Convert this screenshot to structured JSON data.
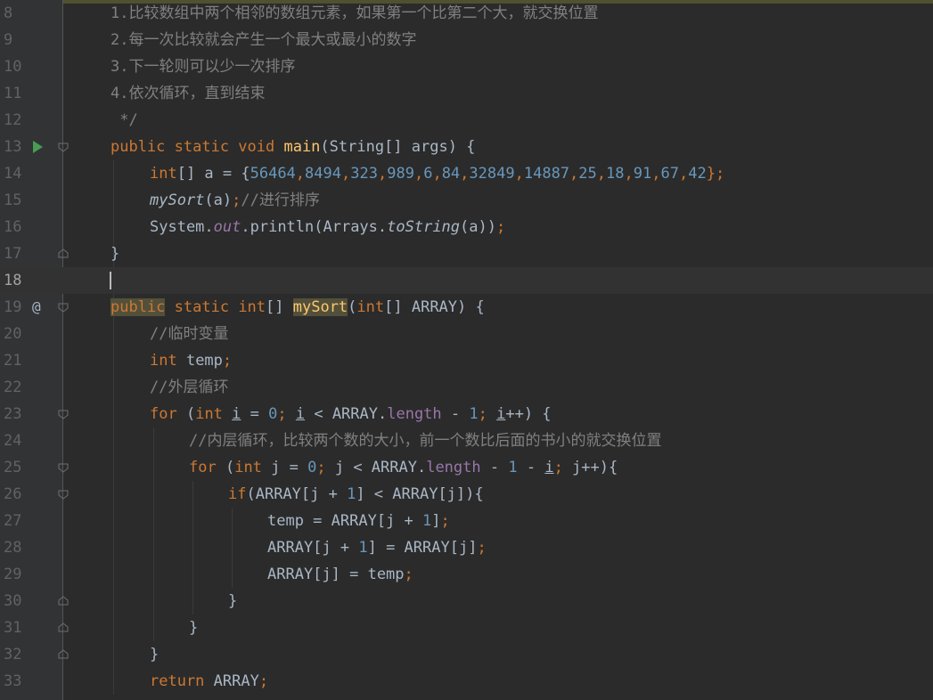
{
  "colors": {
    "background": "#2b2b2b",
    "gutter": "#313335",
    "keyword": "#cc7832",
    "number": "#6897bb",
    "comment": "#808080",
    "function": "#ffc66d",
    "field": "#9876aa",
    "default": "#a9b7c6",
    "run_icon": "#499c54"
  },
  "editor": {
    "line_numbers": [
      "8",
      "9",
      "10",
      "11",
      "12",
      "13",
      "14",
      "15",
      "16",
      "17",
      "18",
      "19",
      "20",
      "21",
      "22",
      "23",
      "24",
      "25",
      "26",
      "27",
      "28",
      "29",
      "30",
      "31",
      "32",
      "33"
    ],
    "gutter_marks": {
      "13": "run-icon",
      "19": "override-icon"
    },
    "fold_markers": [
      "13",
      "17",
      "19",
      "23",
      "25",
      "26",
      "30",
      "31",
      "32"
    ],
    "current_line": "18",
    "lines": {
      "l8": "1.比较数组中两个相邻的数组元素，如果第一个比第二个大，就交换位置",
      "l9": "2.每一次比较就会产生一个最大或最小的数字",
      "l10": "3.下一轮则可以少一次排序",
      "l11": "4.依次循环，直到结束",
      "l12": " */",
      "l13": {
        "kw": "public static void ",
        "fn": "main",
        "rest": "(String[] args) {"
      },
      "l14": {
        "kw": "int",
        "mid": "[] a = {",
        "nums": [
          "56464",
          "8494",
          "323",
          "989",
          "6",
          "84",
          "32849",
          "14887",
          "25",
          "18",
          "91",
          "67",
          "42"
        ],
        "end": "};"
      },
      "l15": {
        "call": "mySort",
        "args": "(a)",
        "semi": ";",
        "comment": "//进行排序"
      },
      "l16": {
        "a": "System.",
        "out": "out",
        "b": ".println(Arrays.",
        "ts": "toString",
        "c": "(a))",
        "semi": ";"
      },
      "l17": "}",
      "l19": {
        "kw1": "public",
        "kw2": " static ",
        "kw3": "int",
        "a": "[] ",
        "fn": "mySort",
        "b": "(",
        "kw4": "int",
        "c": "[] ARRAY) {"
      },
      "l20": "//临时变量",
      "l21": {
        "kw": "int ",
        "a": "temp",
        "semi": ";"
      },
      "l22": "//外层循环",
      "l23": {
        "kw": "for ",
        "a": "(",
        "kw2": "int ",
        "i1": "i",
        "b": " = ",
        "n0": "0",
        "s1": "; ",
        "i2": "i",
        "c": " < ARRAY.",
        "len": "length",
        "d": " - ",
        "n1": "1",
        "s2": "; ",
        "i3": "i",
        "e": "++) {"
      },
      "l24": "//内层循环，比较两个数的大小，前一个数比后面的书小的就交换位置",
      "l25": {
        "kw": "for ",
        "a": "(",
        "kw2": "int ",
        "b": "j = ",
        "n0": "0",
        "s1": "; ",
        "c": "j < ARRAY.",
        "len": "length",
        "d": " - ",
        "n1": "1",
        "e": " - ",
        "i": "i",
        "s2": "; ",
        "f": "j++){"
      },
      "l26": {
        "kw": "if",
        "a": "(ARRAY[j + ",
        "n1": "1",
        "b": "] < ARRAY[j]){"
      },
      "l27": {
        "a": "temp = ARRAY[j + ",
        "n1": "1",
        "b": "]",
        "semi": ";"
      },
      "l28": {
        "a": "ARRAY[j + ",
        "n1": "1",
        "b": "] = ARRAY[j]",
        "semi": ";"
      },
      "l29": {
        "a": "ARRAY[j] = temp",
        "semi": ";"
      },
      "l30": "}",
      "l31": "}",
      "l32": "}",
      "l33": {
        "kw": "return ",
        "a": "ARRAY",
        "semi": ";"
      }
    }
  }
}
